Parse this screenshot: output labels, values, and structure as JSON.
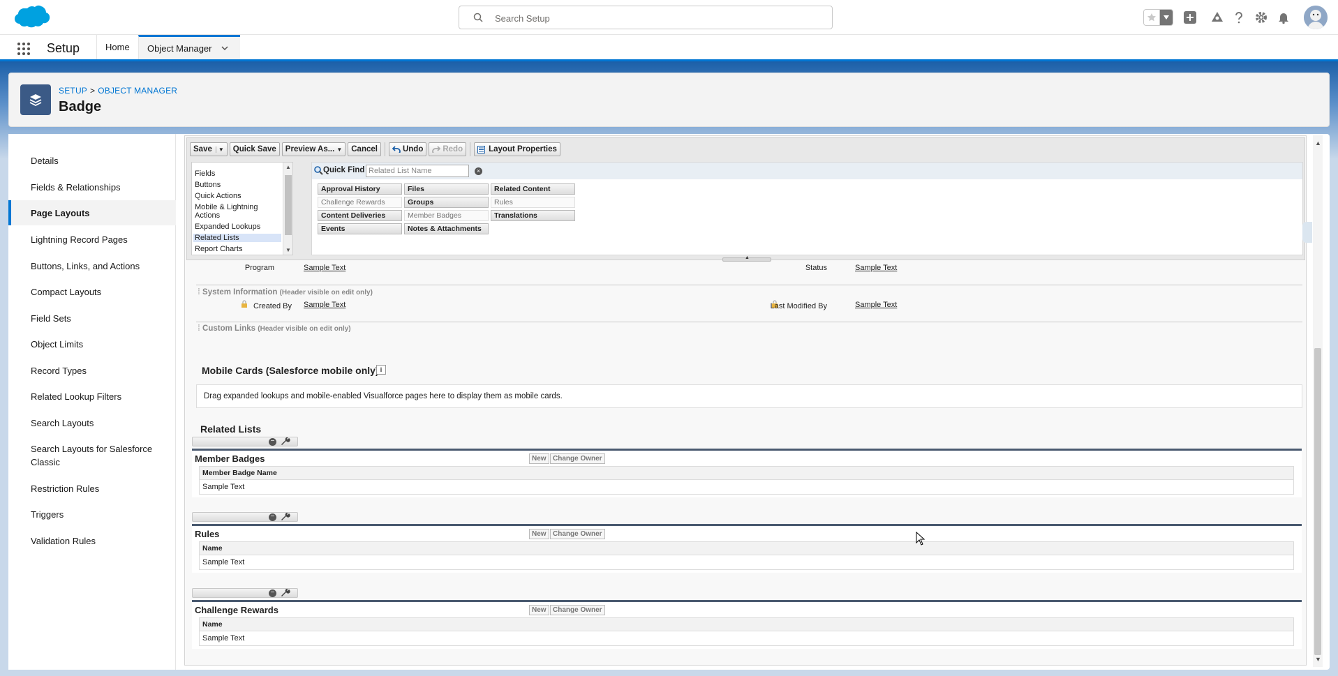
{
  "header": {
    "search_placeholder": "Search Setup"
  },
  "nav": {
    "app_name": "Setup",
    "tabs": [
      {
        "label": "Home"
      },
      {
        "label": "Object Manager"
      }
    ]
  },
  "object": {
    "breadcrumb_setup": "SETUP",
    "breadcrumb_sep": ">",
    "breadcrumb_object_manager": "OBJECT MANAGER",
    "title": "Badge"
  },
  "sidebar": {
    "items": [
      {
        "label": "Details"
      },
      {
        "label": "Fields & Relationships"
      },
      {
        "label": "Page Layouts"
      },
      {
        "label": "Lightning Record Pages"
      },
      {
        "label": "Buttons, Links, and Actions"
      },
      {
        "label": "Compact Layouts"
      },
      {
        "label": "Field Sets"
      },
      {
        "label": "Object Limits"
      },
      {
        "label": "Record Types"
      },
      {
        "label": "Related Lookup Filters"
      },
      {
        "label": "Search Layouts"
      },
      {
        "label": "Search Layouts for Salesforce Classic"
      },
      {
        "label": "Restriction Rules"
      },
      {
        "label": "Triggers"
      },
      {
        "label": "Validation Rules"
      }
    ]
  },
  "toolbar": {
    "save": "Save",
    "quick_save": "Quick Save",
    "preview_as": "Preview As...",
    "cancel": "Cancel",
    "undo": "Undo",
    "redo": "Redo",
    "layout_properties": "Layout Properties"
  },
  "palette": {
    "categories": [
      {
        "label": "Fields"
      },
      {
        "label": "Buttons"
      },
      {
        "label": "Quick Actions"
      },
      {
        "label": "Mobile & Lightning"
      },
      {
        "label": "Actions"
      },
      {
        "label": "Expanded Lookups"
      },
      {
        "label": "Related Lists"
      },
      {
        "label": "Report Charts"
      }
    ],
    "quick_find_label": "Quick Find",
    "quick_find_placeholder": "Related List Name",
    "items": [
      {
        "label": "Approval History"
      },
      {
        "label": "Files"
      },
      {
        "label": "Related Content"
      },
      {
        "label": "Challenge Rewards"
      },
      {
        "label": "Groups"
      },
      {
        "label": "Rules"
      },
      {
        "label": "Content Deliveries"
      },
      {
        "label": "Member Badges"
      },
      {
        "label": "Translations"
      },
      {
        "label": "Events"
      },
      {
        "label": "Notes & Attachments"
      }
    ]
  },
  "layout": {
    "program_label": "Program",
    "status_label": "Status",
    "sample": "Sample Text",
    "system_info_title": "System Information",
    "header_note": "(Header visible on edit only)",
    "created_by_label": "Created By",
    "last_modified_label": "Last Modified By",
    "custom_links_title": "Custom Links",
    "mobile_cards_title": "Mobile Cards (Salesforce mobile only)",
    "info_icon": "i",
    "mobile_cards_hint": "Drag expanded lookups and mobile-enabled Visualforce pages here to display them as mobile cards.",
    "related_lists_title": "Related Lists",
    "related_lists": [
      {
        "name": "Member Badges",
        "column": "Member Badge Name",
        "value": "Sample Text"
      },
      {
        "name": "Rules",
        "column": "Name",
        "value": "Sample Text"
      },
      {
        "name": "Challenge Rewards",
        "column": "Name",
        "value": "Sample Text"
      }
    ],
    "new_button": "New",
    "change_owner_button": "Change Owner"
  }
}
